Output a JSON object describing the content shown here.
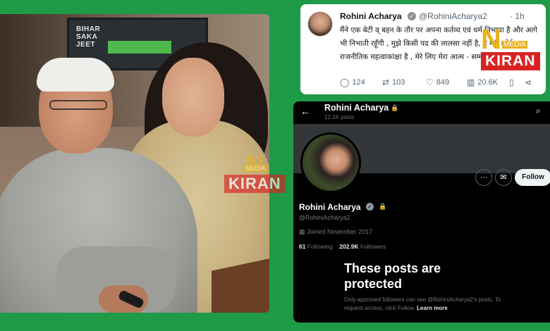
{
  "photo": {
    "tv_text": "BIHAR\nSAKA\nJEET"
  },
  "watermark": {
    "n": "N",
    "media": "MEDIA",
    "kiran": "KIRAN"
  },
  "tweet": {
    "name": "Rohini Acharya",
    "handle": "@RohiniAcharya2",
    "time": "· 1h",
    "body": "मैंने एक बेटी व् बहन के तौर पर अपना कर्तव्य एवं धर्म निभाया है और आगे भी निभाती रहूँगी , मुझे किसी पद की लालसा नहीं है, न मेरी कोई राजनीतिक महत्वाकांक्षा है , मेरे लिए मेरा आत्म - सम्मान सर्वोपरि है 🙏",
    "actions": {
      "reply": "124",
      "retweet": "103",
      "like": "849",
      "views": "20.6K"
    }
  },
  "profile": {
    "header_name": "Rohini Acharya",
    "header_posts": "12.1K posts",
    "follow_label": "Follow",
    "display_name": "Rohini Acharya",
    "handle": "@RohiniAcharya2",
    "joined": "Joined November 2017",
    "following_count": "61",
    "following_label": "Following",
    "followers_count": "202.9K",
    "followers_label": "Followers",
    "protected_title": "These posts are protected",
    "protected_desc": "Only approved followers can see @RohiniAcharya2's posts. To request access, click Follow.",
    "learn_more": "Learn more"
  }
}
